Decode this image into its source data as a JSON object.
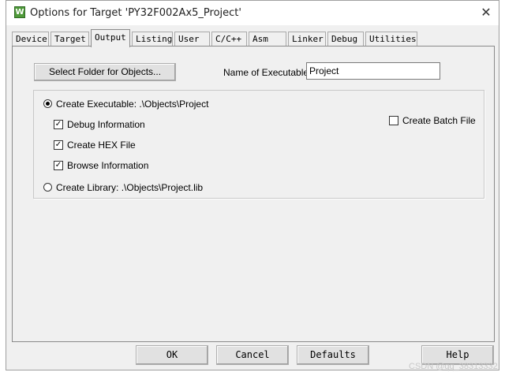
{
  "window": {
    "title": "Options for Target 'PY32F002Ax5_Project'",
    "app_icon": "keil-uvision-icon",
    "app_icon_glyph": "W",
    "close_glyph": "✕"
  },
  "tabs": [
    {
      "label": "Device",
      "active": false
    },
    {
      "label": "Target",
      "active": false
    },
    {
      "label": "Output",
      "active": true
    },
    {
      "label": "Listing",
      "active": false
    },
    {
      "label": "User",
      "active": false
    },
    {
      "label": "C/C++",
      "active": false
    },
    {
      "label": "Asm",
      "active": false
    },
    {
      "label": "Linker",
      "active": false
    },
    {
      "label": "Debug",
      "active": false
    },
    {
      "label": "Utilities",
      "active": false
    }
  ],
  "output": {
    "select_folder_label": "Select Folder for Objects...",
    "name_label": "Name of Executable:",
    "name_value": "Project",
    "create_executable_label": "Create Executable:  .\\Objects\\Project",
    "create_executable_selected": true,
    "debug_info_label": "Debug Information",
    "debug_info_checked": true,
    "hex_file_label": "Create HEX File",
    "hex_file_checked": true,
    "browse_info_label": "Browse Information",
    "browse_info_checked": true,
    "create_library_label": "Create Library:  .\\Objects\\Project.lib",
    "create_library_selected": false,
    "batch_file_label": "Create Batch File",
    "batch_file_checked": false,
    "check_glyph": "✓"
  },
  "footer": {
    "ok_label": "OK",
    "cancel_label": "Cancel",
    "defaults_label": "Defaults",
    "help_label": "Help"
  },
  "watermark": "CSDN @qq_38313332"
}
